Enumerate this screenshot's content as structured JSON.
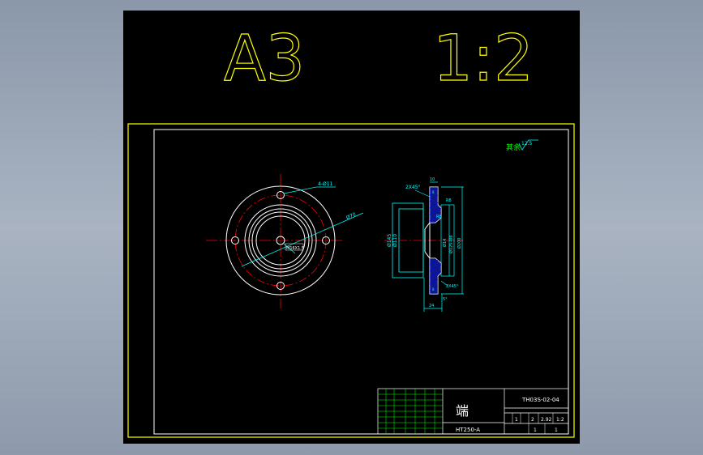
{
  "sheet": {
    "size_label": "A3",
    "scale_label": "1:2"
  },
  "roughness": {
    "prefix": "其余",
    "value": "12.5"
  },
  "front_view": {
    "bolt_circle_label": "4-Ø11",
    "outer_dia_label": "Ø70",
    "thread_label": "M16X1.5"
  },
  "section_view": {
    "left_labels": [
      "2X45°",
      "Ø145",
      "Ø110"
    ],
    "right_labels": [
      "Ø14",
      "Ø125-Ø8",
      "Ø200",
      "R8",
      "R8",
      "2X45°",
      "5°"
    ],
    "width_dims": [
      "10",
      "24"
    ],
    "small_labels": [
      "8",
      "8"
    ]
  },
  "title_block": {
    "part_name": "端",
    "drawing_no": "TH03S-02-04",
    "material": "HT250-A",
    "qty_cells": [
      "1",
      "2",
      "2.92",
      "1:2"
    ],
    "sheet_cells": [
      "1",
      "1"
    ]
  },
  "colors": {
    "background": "#000000",
    "frame": "#ffff00",
    "inner_frame": "#ffffff",
    "centerline": "#ff0000",
    "dimension": "#00ffff",
    "geometry": "#ffffff",
    "hatch": "#0000ff",
    "accent": "#00ff00"
  }
}
